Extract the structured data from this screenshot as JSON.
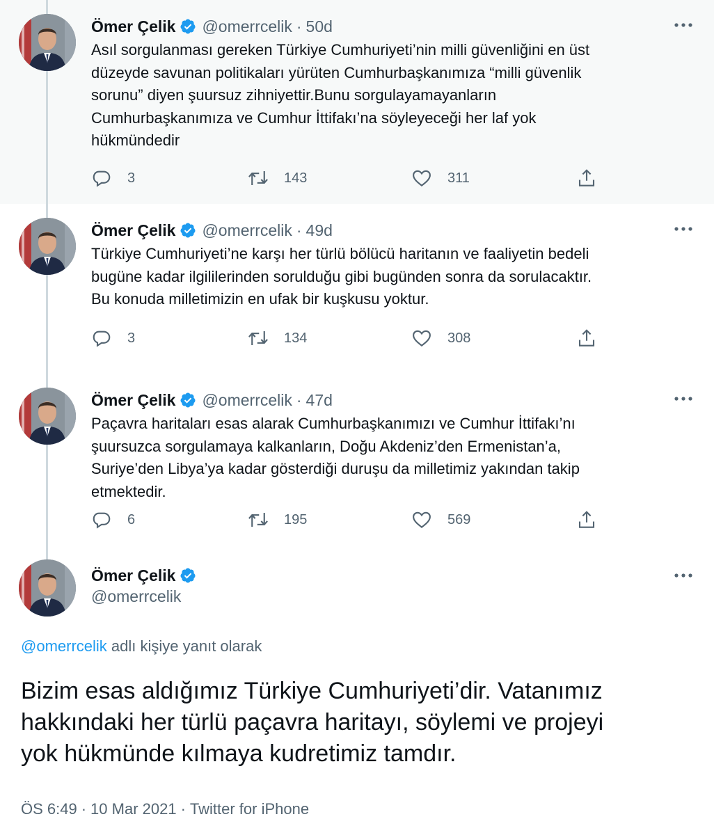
{
  "author": {
    "name": "Ömer Çelik",
    "handle": "@omerrcelik"
  },
  "colors": {
    "verified": "#1d9bf0",
    "link": "#1d9bf0",
    "secondary_text": "#536471",
    "highlight_bg": "#f7f9f9",
    "thread_line": "#cfd9de"
  },
  "icons": [
    "verified-badge-icon",
    "more-options-icon",
    "reply-icon",
    "retweet-icon",
    "like-icon",
    "share-icon"
  ],
  "tweets": [
    {
      "time": "50d",
      "text": "Asıl sorgulanması gereken Türkiye Cumhuriyeti’nin milli güvenliğini en üst\ndüzeyde savunan politikaları yürüten Cumhurbaşkanımıza “milli güvenlik\nsorunu” diyen şuursuz zihniyettir.Bunu sorgulayamayanların\nCumhurbaşkanımıza ve Cumhur İttifakı’na söyleyeceği her laf yok\nhükmündedir",
      "replies": "3",
      "retweets": "143",
      "likes": "311"
    },
    {
      "time": "49d",
      "text": "Türkiye Cumhuriyeti’ne karşı her türlü bölücü haritanın ve faaliyetin bedeli\nbugüne kadar ilgililerinden sorulduğu gibi bugünden sonra da sorulacaktır.\nBu konuda milletimizin en ufak bir kuşkusu yoktur.",
      "replies": "3",
      "retweets": "134",
      "likes": "308"
    },
    {
      "time": "47d",
      "text": "Paçavra haritaları esas alarak Cumhurbaşkanımızı ve Cumhur İttifakı’nı\nşuursuzca sorgulamaya kalkanların, Doğu Akdeniz’den Ermenistan’a,\nSuriye’den Libya’ya kadar gösterdiği duruşu da milletimiz yakından takip\netmektedir.",
      "replies": "6",
      "retweets": "195",
      "likes": "569"
    }
  ],
  "main_tweet": {
    "replying_handle": "@omerrcelik",
    "replying_suffix": "adlı kişiye yanıt olarak",
    "text": "Bizim esas aldığımız Türkiye Cumhuriyeti’dir. Vatanımız\nhakkındaki her türlü paçavra haritayı, söylemi ve projeyi\nyok hükmünde kılmaya kudretimiz tamdır.",
    "time": "ÖS 6:49",
    "date": "10 Mar 2021",
    "source": "Twitter for iPhone"
  }
}
